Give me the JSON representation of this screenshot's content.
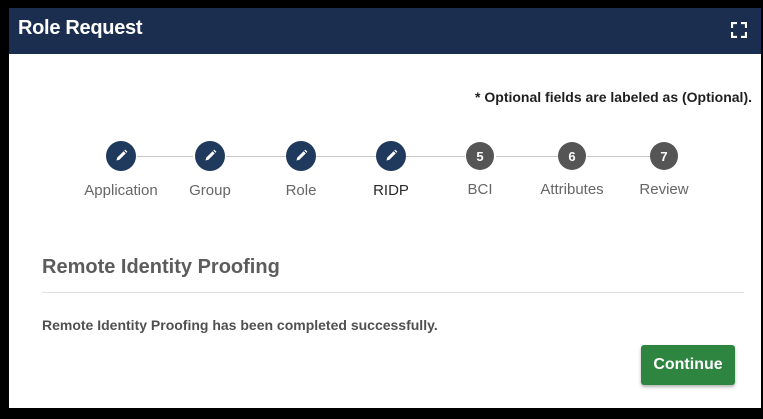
{
  "header": {
    "title": "Role Request",
    "expand_icon": "expand-icon"
  },
  "optional_note": "* Optional fields are labeled as (Optional).",
  "stepper": {
    "steps": [
      {
        "label": "Application",
        "marker": "",
        "status": "complete",
        "icon": "pencil-icon"
      },
      {
        "label": "Group",
        "marker": "",
        "status": "complete",
        "icon": "pencil-icon"
      },
      {
        "label": "Role",
        "marker": "",
        "status": "complete",
        "icon": "pencil-icon"
      },
      {
        "label": "RIDP",
        "marker": "",
        "status": "current",
        "icon": "pencil-icon"
      },
      {
        "label": "BCI",
        "marker": "5",
        "status": "pending"
      },
      {
        "label": "Attributes",
        "marker": "6",
        "status": "pending"
      },
      {
        "label": "Review",
        "marker": "7",
        "status": "pending"
      }
    ]
  },
  "section": {
    "title": "Remote Identity Proofing",
    "message": "Remote Identity Proofing has been completed successfully."
  },
  "actions": {
    "continue_label": "Continue"
  },
  "colors": {
    "header_bg": "#1c2e4f",
    "step_complete": "#1f3a5c",
    "step_pending": "#555555",
    "continue_bg": "#2e8540"
  }
}
